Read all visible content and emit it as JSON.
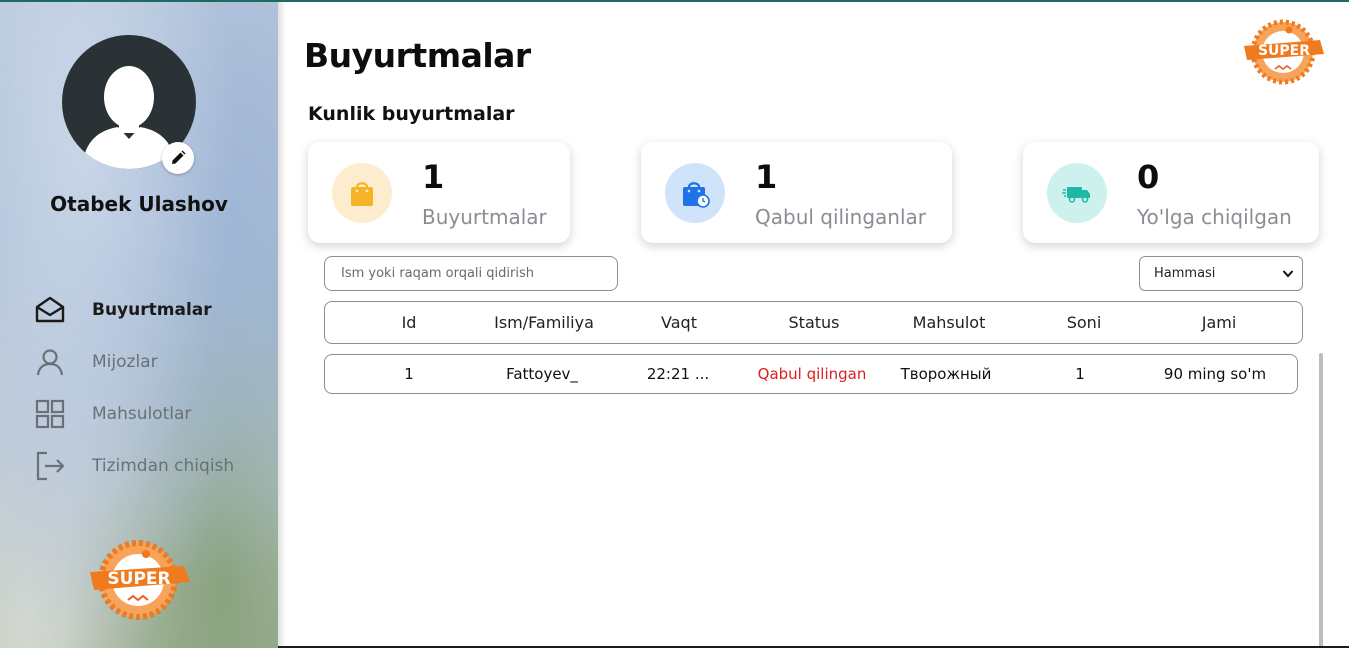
{
  "user": {
    "name": "Otabek Ulashov"
  },
  "sidebar": {
    "items": [
      {
        "label": "Buyurtmalar",
        "icon": "envelope-open-icon",
        "active": true
      },
      {
        "label": "Mijozlar",
        "icon": "user-icon",
        "active": false
      },
      {
        "label": "Mahsulotlar",
        "icon": "grid-icon",
        "active": false
      },
      {
        "label": "Tizimdan chiqish",
        "icon": "logout-icon",
        "active": false
      }
    ]
  },
  "logo": {
    "text": "SUPER",
    "color": "#f07a1e"
  },
  "header": {
    "title": "Buyurtmalar"
  },
  "daily": {
    "title": "Kunlik buyurtmalar",
    "cards": [
      {
        "value": "1",
        "label": "Buyurtmalar",
        "icon": "shopping-bag-icon",
        "bg": "#fdeccd",
        "color": "#f5b427"
      },
      {
        "value": "1",
        "label": "Qabul qilinganlar",
        "icon": "bag-clock-icon",
        "bg": "#cfe3fb",
        "color": "#1f73e8"
      },
      {
        "value": "0",
        "label": "Yo'lga chiqilgan",
        "icon": "delivery-truck-icon",
        "bg": "#cdf1ed",
        "color": "#20b7a6"
      }
    ]
  },
  "search": {
    "placeholder": "Ism yoki raqam orqali qidirish",
    "value": ""
  },
  "filter": {
    "selected": "Hammasi"
  },
  "table": {
    "columns": [
      "Id",
      "Ism/Familiya",
      "Vaqt",
      "Status",
      "Mahsulot",
      "Soni",
      "Jami"
    ],
    "rows": [
      {
        "id": "1",
        "name": "Fattoyev_",
        "time": "22:21 ...",
        "status": "Qabul qilingan",
        "product": "Творожный",
        "count": "1",
        "total": "90 ming so'm"
      }
    ]
  },
  "colors": {
    "status_accepted": "#e11d1d",
    "accent_line": "#1b6b63"
  }
}
